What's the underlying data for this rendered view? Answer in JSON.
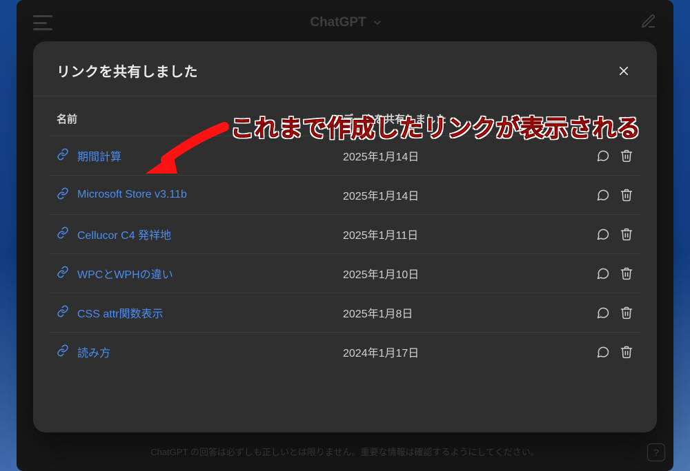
{
  "app": {
    "title": "ChatGPT",
    "disclaimer": "ChatGPT の回答は必ずしも正しいとは限りません。重要な情報は確認するようにしてください。",
    "help_label": "?"
  },
  "modal": {
    "title": "リンクを共有しました",
    "columns": {
      "name": "名前",
      "date": "データを共有しました",
      "more": "•••"
    },
    "rows": [
      {
        "title": "期間計算",
        "date": "2025年1月14日"
      },
      {
        "title": "Microsoft Store v3.11b",
        "date": "2025年1月14日"
      },
      {
        "title": "Cellucor C4 発祥地",
        "date": "2025年1月11日"
      },
      {
        "title": "WPCとWPHの違い",
        "date": "2025年1月10日"
      },
      {
        "title": "CSS attr関数表示",
        "date": "2025年1月8日"
      },
      {
        "title": "読み方",
        "date": "2024年1月17日"
      }
    ]
  },
  "annotation": {
    "text": "これまで作成したリンクが表示される"
  }
}
